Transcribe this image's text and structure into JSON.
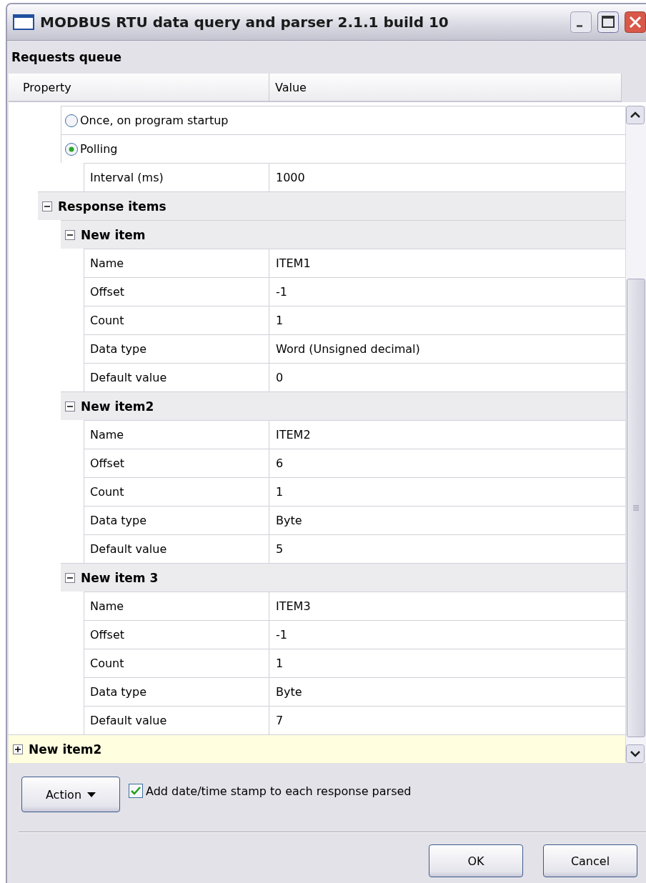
{
  "window": {
    "title": "MODBUS RTU data query and parser 2.1.1 build 10"
  },
  "panel_title": "Requests queue",
  "grid": {
    "columns": [
      "Property",
      "Value"
    ],
    "rows": [
      {
        "kind": "continued",
        "children": [
          {
            "kind": "continued",
            "children": [
              {
                "kind": "radio",
                "label": "Once, on program startup",
                "selected": false
              },
              {
                "kind": "radio",
                "label": "Polling",
                "selected": true,
                "children": [
                  {
                    "kind": "property",
                    "label": "Interval (ms)",
                    "value": "1000"
                  }
                ]
              }
            ]
          },
          {
            "kind": "category",
            "label": "Response items",
            "expanded": true,
            "selected": false,
            "children": [
              {
                "kind": "category",
                "label": "New item",
                "expanded": true,
                "selected": false,
                "children": [
                  {
                    "kind": "property",
                    "label": "Name",
                    "value": "ITEM1"
                  },
                  {
                    "kind": "property",
                    "label": "Offset",
                    "value": "-1"
                  },
                  {
                    "kind": "property",
                    "label": "Count",
                    "value": "1"
                  },
                  {
                    "kind": "property",
                    "label": "Data type",
                    "value": "Word (Unsigned decimal)"
                  },
                  {
                    "kind": "property",
                    "label": "Default value",
                    "value": "0"
                  }
                ]
              },
              {
                "kind": "category",
                "label": "New item2",
                "expanded": true,
                "selected": false,
                "children": [
                  {
                    "kind": "property",
                    "label": "Name",
                    "value": "ITEM2"
                  },
                  {
                    "kind": "property",
                    "label": "Offset",
                    "value": "6"
                  },
                  {
                    "kind": "property",
                    "label": "Count",
                    "value": "1"
                  },
                  {
                    "kind": "property",
                    "label": "Data type",
                    "value": "Byte"
                  },
                  {
                    "kind": "property",
                    "label": "Default value",
                    "value": "5"
                  }
                ]
              },
              {
                "kind": "category",
                "label": "New item 3",
                "expanded": true,
                "selected": false,
                "children": [
                  {
                    "kind": "property",
                    "label": "Name",
                    "value": "ITEM3"
                  },
                  {
                    "kind": "property",
                    "label": "Offset",
                    "value": "-1"
                  },
                  {
                    "kind": "property",
                    "label": "Count",
                    "value": "1"
                  },
                  {
                    "kind": "property",
                    "label": "Data type",
                    "value": "Byte"
                  },
                  {
                    "kind": "property",
                    "label": "Default value",
                    "value": "7"
                  }
                ]
              }
            ]
          }
        ]
      },
      {
        "kind": "category",
        "label": "New item2",
        "expanded": false,
        "selected": true
      }
    ]
  },
  "action_button": {
    "label": "Action"
  },
  "timestamp_checkbox": {
    "label": "Add date/time stamp to each response parsed",
    "checked": true
  },
  "buttons": [
    "OK",
    "Cancel"
  ]
}
